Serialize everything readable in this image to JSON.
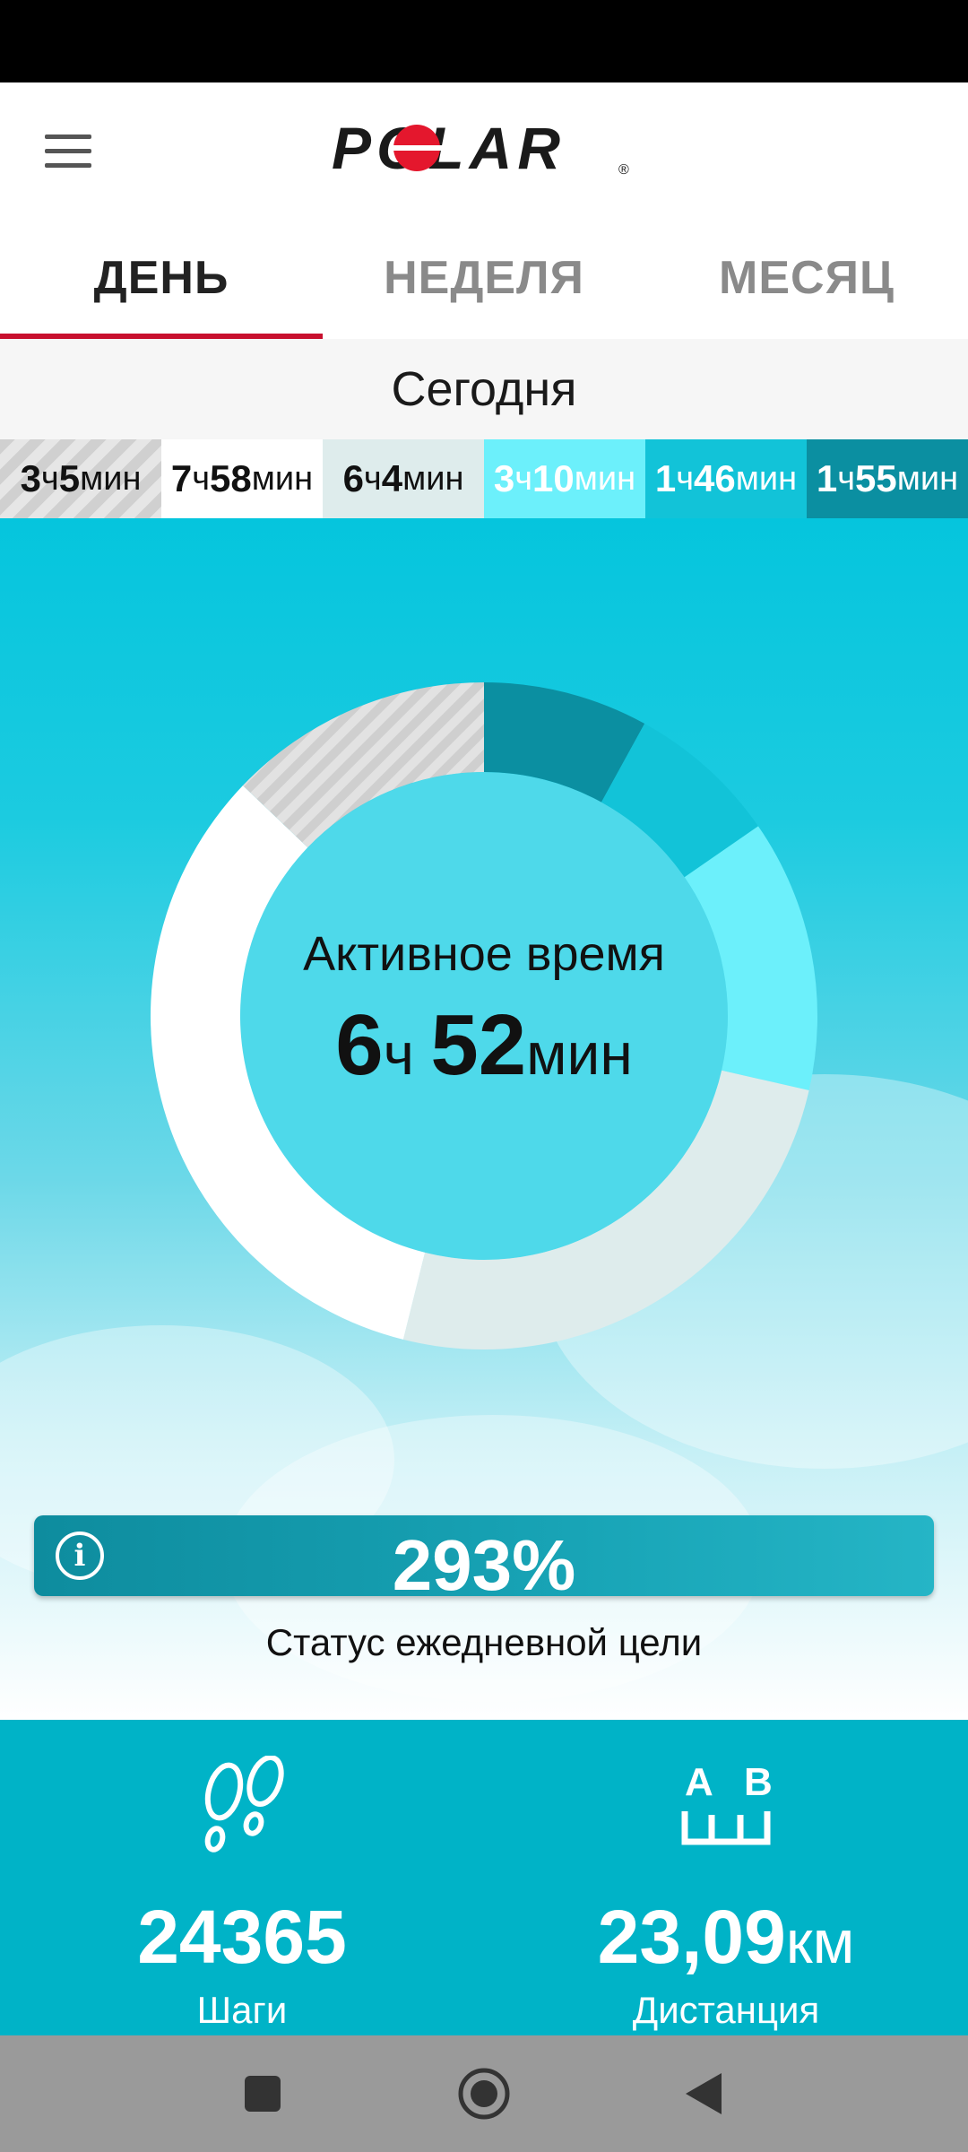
{
  "header": {
    "logo_text": "POLAR",
    "logo_mark": "®"
  },
  "tabs": [
    {
      "label": "ДЕНЬ",
      "active": true
    },
    {
      "label": "НЕДЕЛЯ",
      "active": false
    },
    {
      "label": "МЕСЯЦ",
      "active": false
    }
  ],
  "date_label": "Сегодня",
  "zones": [
    {
      "h": "3",
      "h_unit": "ч",
      "m": "5",
      "m_unit": "мин",
      "color": "#d8d8d8"
    },
    {
      "h": "7",
      "h_unit": "ч",
      "m": "58",
      "m_unit": "мин",
      "color": "#ffffff"
    },
    {
      "h": "6",
      "h_unit": "ч",
      "m": "4",
      "m_unit": "мин",
      "color": "#deecec"
    },
    {
      "h": "3",
      "h_unit": "ч",
      "m": "10",
      "m_unit": "мин",
      "color": "#6cf0fb"
    },
    {
      "h": "1",
      "h_unit": "ч",
      "m": "46",
      "m_unit": "мин",
      "color": "#12c3d8"
    },
    {
      "h": "1",
      "h_unit": "ч",
      "m": "55",
      "m_unit": "мин",
      "color": "#0b8fa1"
    }
  ],
  "activity": {
    "label": "Активное время",
    "hours": "6",
    "hours_unit": "ч",
    "minutes": "52",
    "minutes_unit": "мин"
  },
  "goal": {
    "percent": "293%",
    "caption": "Статус ежедневной цели",
    "icon": "info-icon"
  },
  "stats": {
    "steps": {
      "value": "24365",
      "label": "Шаги",
      "icon": "footprints-icon"
    },
    "distance": {
      "value": "23,09",
      "unit": "км",
      "label": "Дистанция",
      "icon": "a-to-b-distance-icon",
      "icon_letters": [
        "A",
        "B"
      ]
    }
  },
  "colors": {
    "brand_red": "#c8102e",
    "zone_sedentary": "#d8d8d8",
    "zone_low": "#ffffff",
    "zone_medium": "#deecec",
    "zone_high": "#6cf0fb",
    "zone_higher": "#12c3d8",
    "zone_highest": "#0b8fa1",
    "stats_bg": "#00b3c7"
  }
}
